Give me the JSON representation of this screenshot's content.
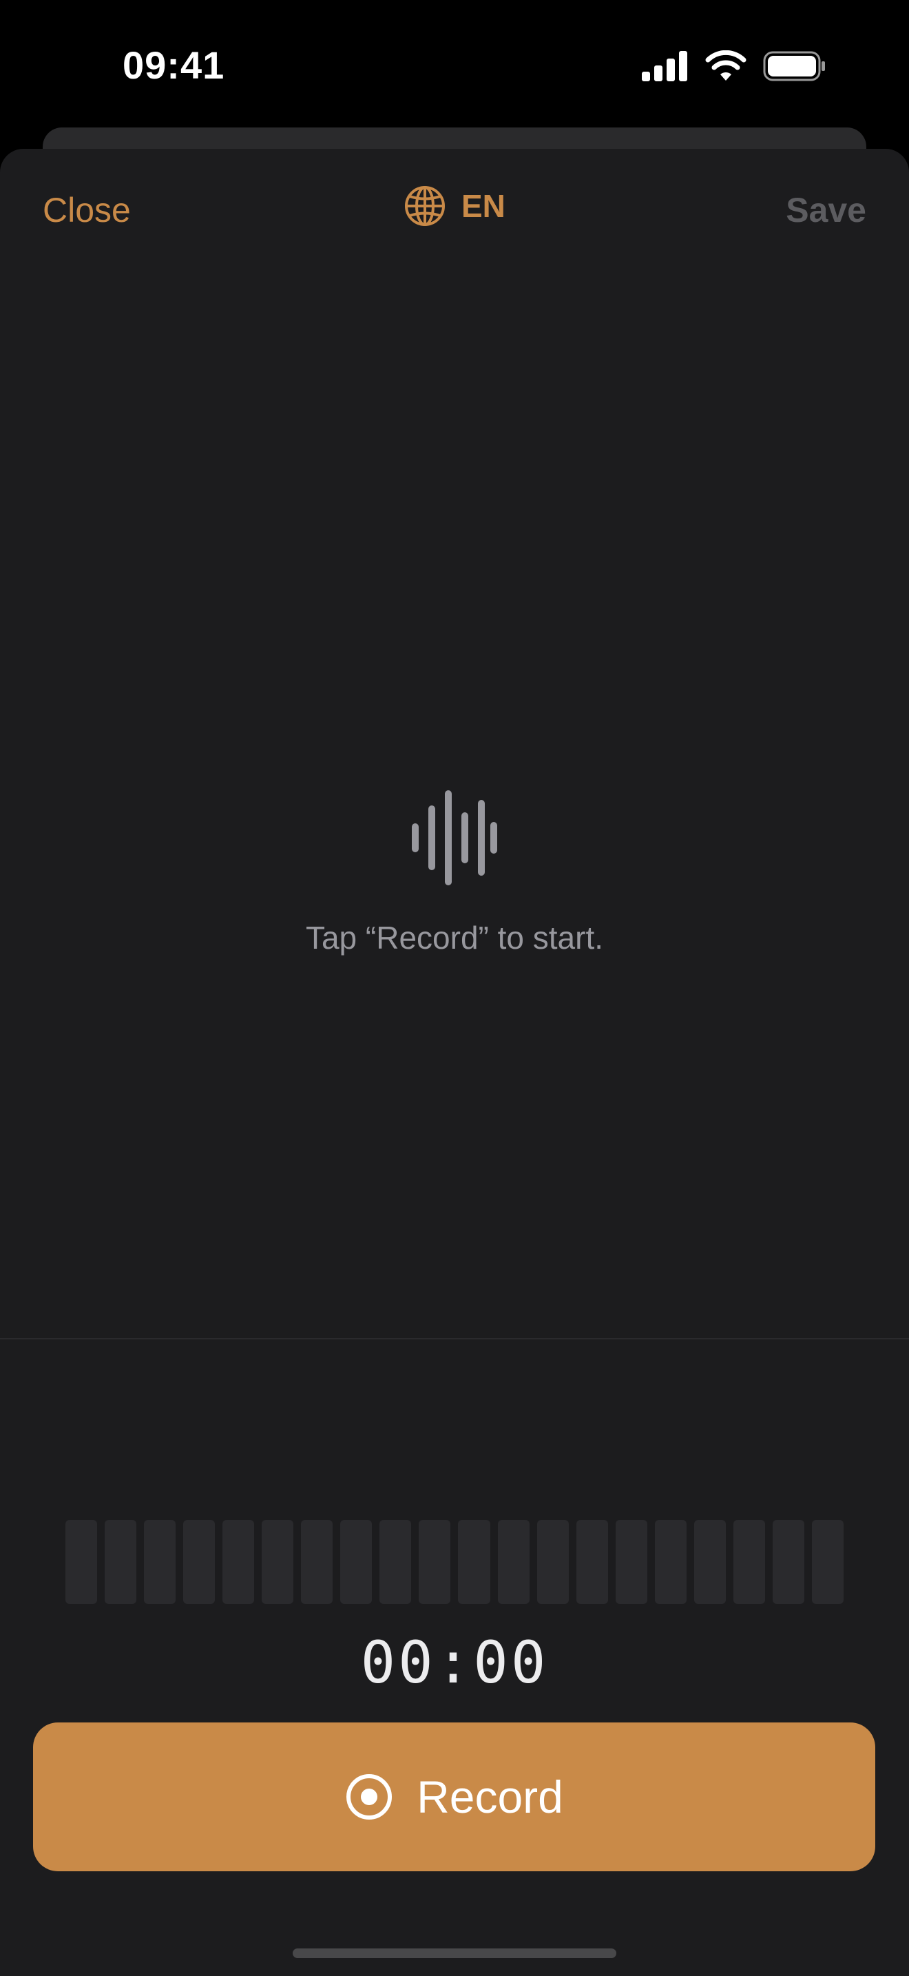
{
  "status_bar": {
    "time": "09:41",
    "icons": [
      "cellular-signal-icon",
      "wifi-icon",
      "battery-icon"
    ]
  },
  "nav": {
    "close_label": "Close",
    "language_label": "EN",
    "language_icon": "globe-icon",
    "save_label": "Save"
  },
  "empty_state": {
    "icon": "waveform-icon",
    "text": "Tap “Record” to start."
  },
  "level_meter": {
    "bar_count": 20,
    "level": 0
  },
  "timer": "00:00",
  "record_button": {
    "label": "Record",
    "icon": "record-circle-icon"
  },
  "colors": {
    "accent": "#c98a48",
    "sheet_background": "#1c1c1e",
    "disabled_text": "#5c5c60",
    "secondary_text": "#98989e"
  }
}
